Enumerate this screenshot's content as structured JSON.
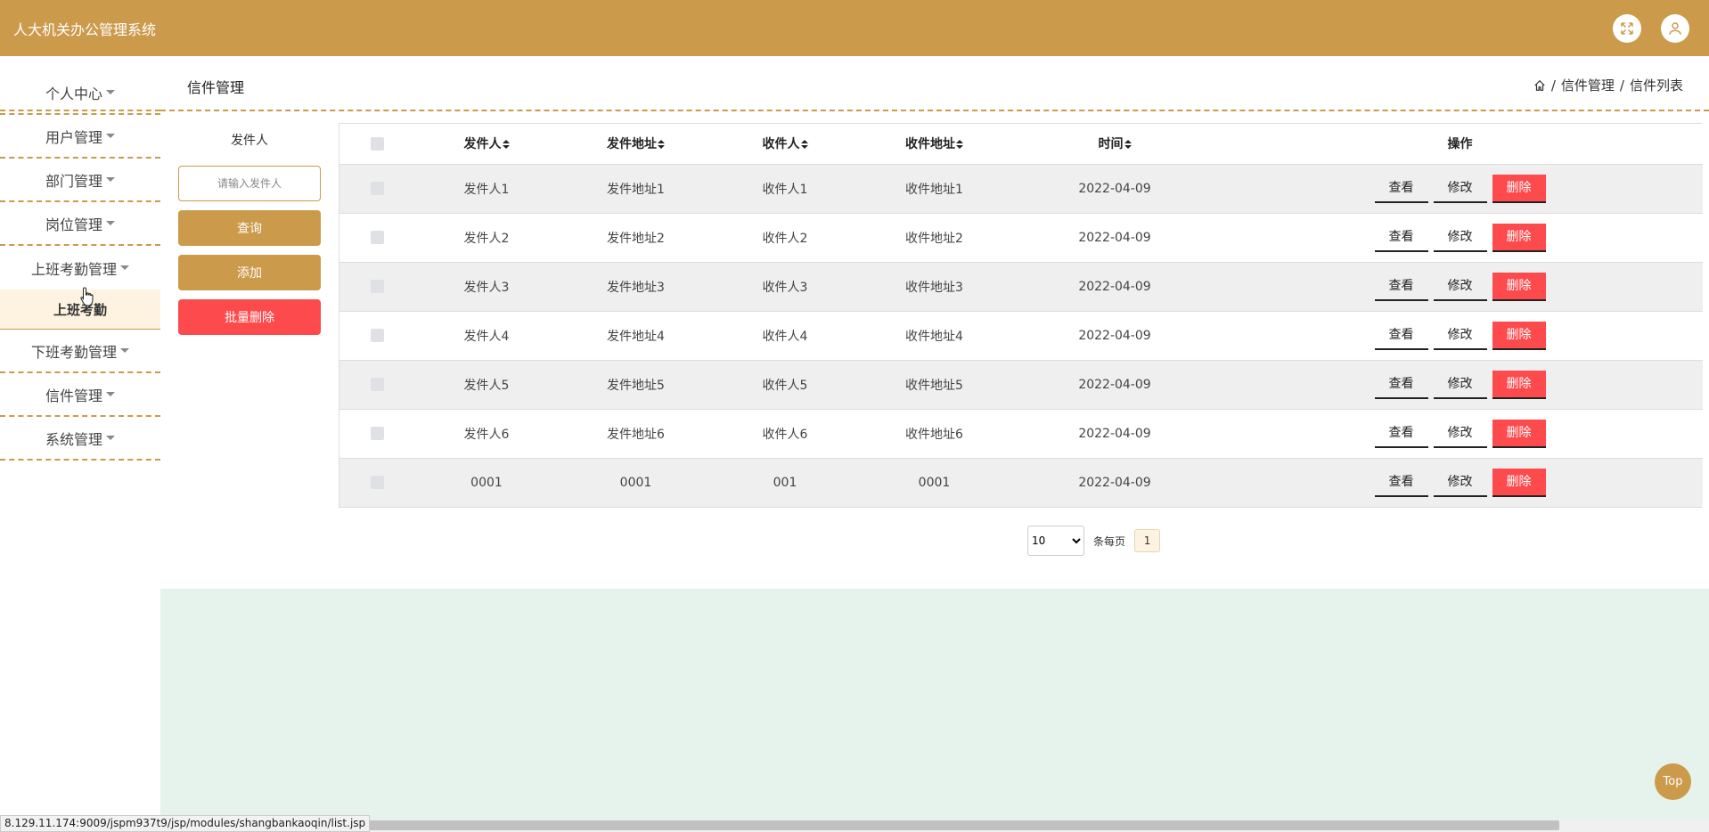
{
  "app": {
    "title": "人大机关办公管理系统"
  },
  "header": {
    "fullscreen_icon": "fullscreen-icon",
    "user_icon": "user-icon"
  },
  "sidebar": {
    "items": [
      {
        "label": "个人中心"
      },
      {
        "label": "用户管理"
      },
      {
        "label": "部门管理"
      },
      {
        "label": "岗位管理"
      },
      {
        "label": "上班考勤管理"
      },
      {
        "label": "下班考勤管理"
      },
      {
        "label": "信件管理"
      },
      {
        "label": "系统管理"
      }
    ],
    "open_sub": {
      "label": "上班考勤"
    }
  },
  "page": {
    "title": "信件管理",
    "breadcrumb": [
      "信件管理",
      "信件列表"
    ],
    "breadcrumb_sep": "/"
  },
  "search": {
    "label": "发件人",
    "placeholder": "请输入发件人",
    "query_label": "查询",
    "add_label": "添加",
    "batch_delete_label": "批量删除"
  },
  "table": {
    "columns": [
      "发件人",
      "发件地址",
      "收件人",
      "收件地址",
      "时间",
      "操作"
    ],
    "rows": [
      {
        "sender": "发件人1",
        "sender_addr": "发件地址1",
        "receiver": "收件人1",
        "receiver_addr": "收件地址1",
        "time": "2022-04-09"
      },
      {
        "sender": "发件人2",
        "sender_addr": "发件地址2",
        "receiver": "收件人2",
        "receiver_addr": "收件地址2",
        "time": "2022-04-09"
      },
      {
        "sender": "发件人3",
        "sender_addr": "发件地址3",
        "receiver": "收件人3",
        "receiver_addr": "收件地址3",
        "time": "2022-04-09"
      },
      {
        "sender": "发件人4",
        "sender_addr": "发件地址4",
        "receiver": "收件人4",
        "receiver_addr": "收件地址4",
        "time": "2022-04-09"
      },
      {
        "sender": "发件人5",
        "sender_addr": "发件地址5",
        "receiver": "收件人5",
        "receiver_addr": "收件地址5",
        "time": "2022-04-09"
      },
      {
        "sender": "发件人6",
        "sender_addr": "发件地址6",
        "receiver": "收件人6",
        "receiver_addr": "收件地址6",
        "time": "2022-04-09"
      },
      {
        "sender": "0001",
        "sender_addr": "0001",
        "receiver": "001",
        "receiver_addr": "0001",
        "time": "2022-04-09"
      }
    ],
    "actions": {
      "view": "查看",
      "edit": "修改",
      "delete": "删除"
    }
  },
  "pagination": {
    "page_size": "10",
    "per_page_label": "条每页",
    "current_page": "1"
  },
  "footer": {
    "top_label": "Top",
    "status_url": "8.129.11.174:9009/jspm937t9/jsp/modules/shangbankaoqin/list.jsp"
  },
  "colors": {
    "primary": "#cc9a4b",
    "danger": "#fd4a4d",
    "footer_bg": "#e6f3ec"
  }
}
